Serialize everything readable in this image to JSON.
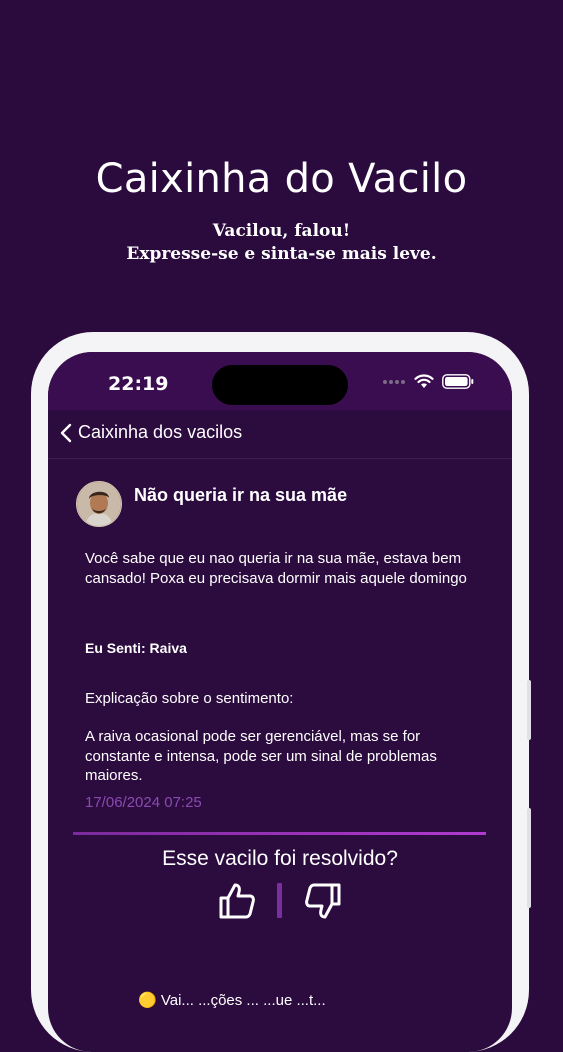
{
  "promo": {
    "title": "Caixinha do Vacilo",
    "subtitle_line1": "Vacilou, falou!",
    "subtitle_line2": "Expresse-se e sinta-se mais leve."
  },
  "status_bar": {
    "time": "22:19",
    "icons": [
      "signal-dots-icon",
      "wifi-icon",
      "battery-icon"
    ]
  },
  "nav": {
    "back_label": "Caixinha dos vacilos",
    "back_icon": "chevron-left-icon"
  },
  "post": {
    "title": "Não queria ir na sua mãe",
    "body": "Você sabe que eu nao queria ir na sua mãe, estava bem cansado! Poxa eu precisava dormir mais aquele domingo",
    "feeling": "Eu Senti: Raiva",
    "explanation_label": "Explicação sobre o sentimento:",
    "explanation": "A raiva ocasional pode ser gerenciável, mas se for constante e intensa, pode ser um sinal de problemas maiores.",
    "timestamp": "17/06/2024 07:25"
  },
  "resolution": {
    "question": "Esse vacilo foi resolvido?",
    "icons": [
      "thumbs-up-icon",
      "thumbs-down-icon"
    ]
  },
  "bottom": {
    "partial_text": "🟡  Vai...  ...ções ... ...ue ...t..."
  },
  "colors": {
    "background": "#2b0b3d",
    "accent": "#a23bc7",
    "timestamp": "#8a4bb0"
  }
}
